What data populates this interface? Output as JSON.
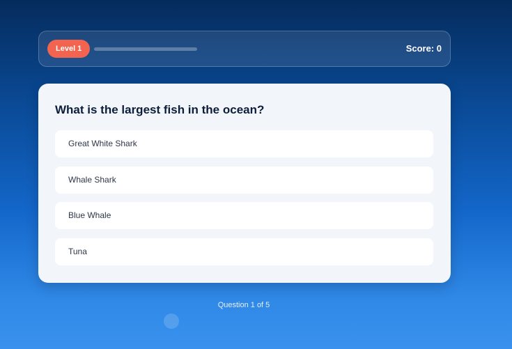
{
  "header": {
    "level_label": "Level 1",
    "score_label": "Score: 0",
    "progress_fraction": 0
  },
  "quiz": {
    "question": "What is the largest fish in the ocean?",
    "options": [
      {
        "label": "Great White Shark"
      },
      {
        "label": "Whale Shark"
      },
      {
        "label": "Blue Whale"
      },
      {
        "label": "Tuna"
      }
    ]
  },
  "footer": {
    "question_counter": "Question 1 of 5"
  },
  "colors": {
    "level_badge": "#f2644f",
    "card_background": "#f2f5f9",
    "question_text": "#0c1e3b"
  }
}
